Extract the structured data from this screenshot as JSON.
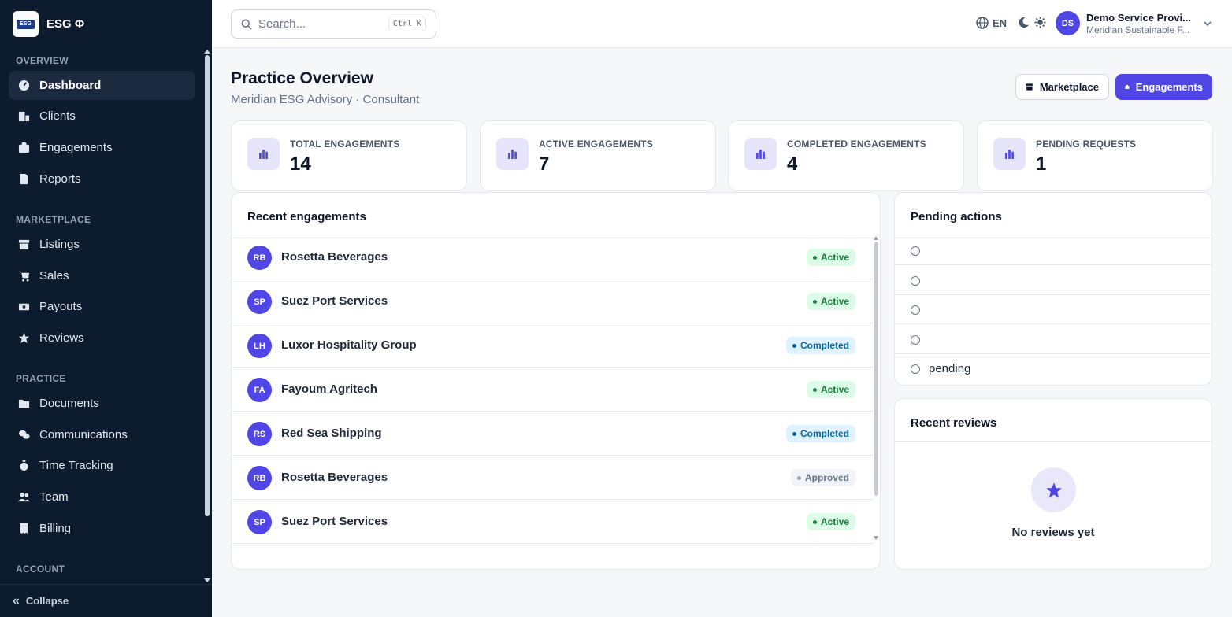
{
  "brand": {
    "name": "ESG Φ",
    "logo_text": "ESG"
  },
  "sidebar": {
    "sections": [
      {
        "label": "OVERVIEW"
      },
      {
        "label": "MARKETPLACE"
      },
      {
        "label": "PRACTICE"
      },
      {
        "label": "ACCOUNT"
      }
    ],
    "items": [
      {
        "label": "Dashboard",
        "icon": "dashboard-icon",
        "active": true
      },
      {
        "label": "Clients",
        "icon": "building-icon"
      },
      {
        "label": "Engagements",
        "icon": "briefcase-icon"
      },
      {
        "label": "Reports",
        "icon": "file-icon"
      },
      {
        "label": "Listings",
        "icon": "store-icon"
      },
      {
        "label": "Sales",
        "icon": "cart-icon"
      },
      {
        "label": "Payouts",
        "icon": "money-icon"
      },
      {
        "label": "Reviews",
        "icon": "star-icon"
      },
      {
        "label": "Documents",
        "icon": "folder-icon"
      },
      {
        "label": "Communications",
        "icon": "chat-icon"
      },
      {
        "label": "Time Tracking",
        "icon": "stopwatch-icon"
      },
      {
        "label": "Team",
        "icon": "users-icon"
      },
      {
        "label": "Billing",
        "icon": "receipt-icon"
      }
    ],
    "collapse_label": "Collapse"
  },
  "header": {
    "search_placeholder": "Search...",
    "search_shortcut": "Ctrl K",
    "language": "EN",
    "user": {
      "initials": "DS",
      "name": "Demo Service Provi...",
      "org": "Meridian Sustainable F..."
    }
  },
  "page": {
    "title": "Practice Overview",
    "subtitle": "Meridian ESG Advisory · Consultant",
    "buttons": {
      "marketplace": "Marketplace",
      "engagements": "Engagements"
    }
  },
  "stats": [
    {
      "label": "TOTAL ENGAGEMENTS",
      "value": "14"
    },
    {
      "label": "ACTIVE ENGAGEMENTS",
      "value": "7"
    },
    {
      "label": "COMPLETED ENGAGEMENTS",
      "value": "4"
    },
    {
      "label": "PENDING REQUESTS",
      "value": "1"
    }
  ],
  "recent_engagements": {
    "title": "Recent engagements",
    "rows": [
      {
        "initials": "RB",
        "name": "Rosetta Beverages",
        "status": "Active",
        "kind": "active"
      },
      {
        "initials": "SP",
        "name": "Suez Port Services",
        "status": "Active",
        "kind": "active"
      },
      {
        "initials": "LH",
        "name": "Luxor Hospitality Group",
        "status": "Completed",
        "kind": "completed"
      },
      {
        "initials": "FA",
        "name": "Fayoum Agritech",
        "status": "Active",
        "kind": "active"
      },
      {
        "initials": "RS",
        "name": "Red Sea Shipping",
        "status": "Completed",
        "kind": "completed"
      },
      {
        "initials": "RB",
        "name": "Rosetta Beverages",
        "status": "Approved",
        "kind": "approved"
      },
      {
        "initials": "SP",
        "name": "Suez Port Services",
        "status": "Active",
        "kind": "active"
      }
    ]
  },
  "pending_actions": {
    "title": "Pending actions",
    "items": [
      {
        "text": ""
      },
      {
        "text": ""
      },
      {
        "text": ""
      },
      {
        "text": ""
      },
      {
        "text": "pending"
      }
    ]
  },
  "recent_reviews": {
    "title": "Recent reviews",
    "empty_text": "No reviews yet"
  },
  "colors": {
    "sidebar_bg": "#0d1b2e",
    "accent": "#4f46e5",
    "active_badge": "#15803d",
    "completed_badge": "#0369a1"
  }
}
